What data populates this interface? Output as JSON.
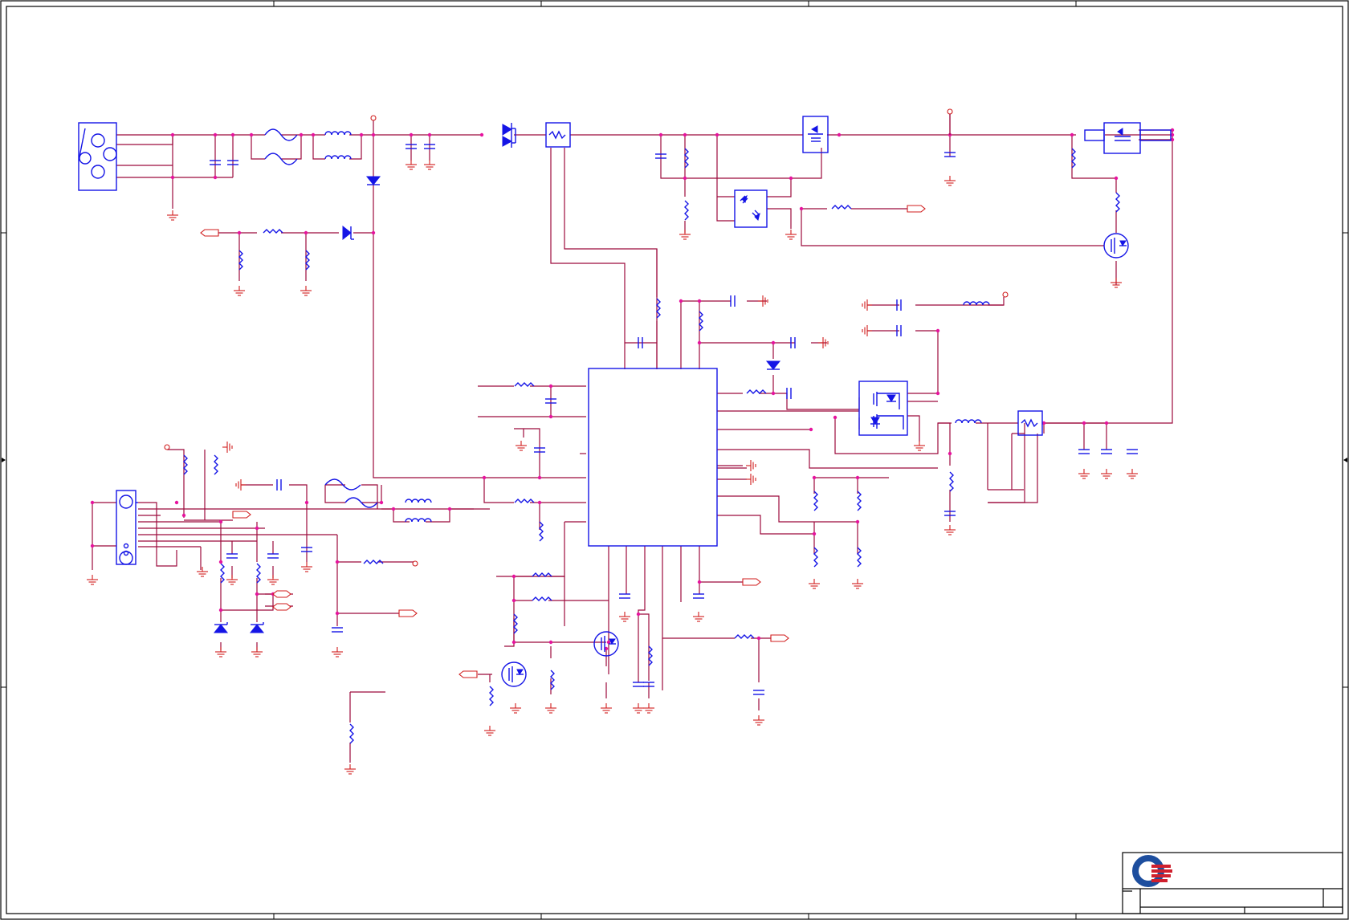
{
  "sheet": {
    "type": "schematic",
    "frame_color": "#000000",
    "wire_color": "#9c0a3c",
    "component_color": "#1414e6",
    "junction_color": "#e6149e",
    "ground_color": "#d01c1c"
  },
  "title_block": {
    "logo_icon": "company-logo-icon",
    "logo_colors": [
      "#1d4e9e",
      "#d0202e"
    ]
  }
}
